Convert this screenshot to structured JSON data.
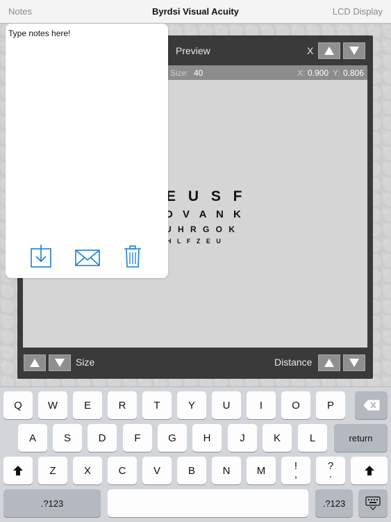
{
  "nav": {
    "left": "Notes",
    "title": "Byrdsi Visual Acuity",
    "right": "LCD Display"
  },
  "preview": {
    "title": "Preview",
    "axis": "X",
    "info": {
      "size_label": "Size:",
      "size_value": "40",
      "x_label": "X:",
      "x_value": "0.900",
      "y_label": "Y:",
      "y_value": "0.806"
    },
    "chart_rows": [
      "E U S F",
      "D V A N K",
      "U H R G O K",
      "H L F Z E U"
    ],
    "footer": {
      "size_label": "Size",
      "distance_label": "Distance"
    }
  },
  "notes": {
    "placeholder": "Type notes here!",
    "icons": [
      "save-icon",
      "mail-icon",
      "trash-icon"
    ]
  },
  "keyboard": {
    "row1": [
      "Q",
      "W",
      "E",
      "R",
      "T",
      "Y",
      "U",
      "I",
      "O",
      "P"
    ],
    "row2": [
      "A",
      "S",
      "D",
      "F",
      "G",
      "H",
      "J",
      "K",
      "L"
    ],
    "return_label": "return",
    "row3": [
      "Z",
      "X",
      "C",
      "V",
      "B",
      "N",
      "M"
    ],
    "excl": {
      "top": "!",
      "bottom": ","
    },
    "quest": {
      "top": "?",
      "bottom": "."
    },
    "num_label": ".?123"
  },
  "colors": {
    "panel": "#3a3a3a",
    "accent_blue": "#1a7fd0",
    "screen": "#d5d5d5"
  }
}
